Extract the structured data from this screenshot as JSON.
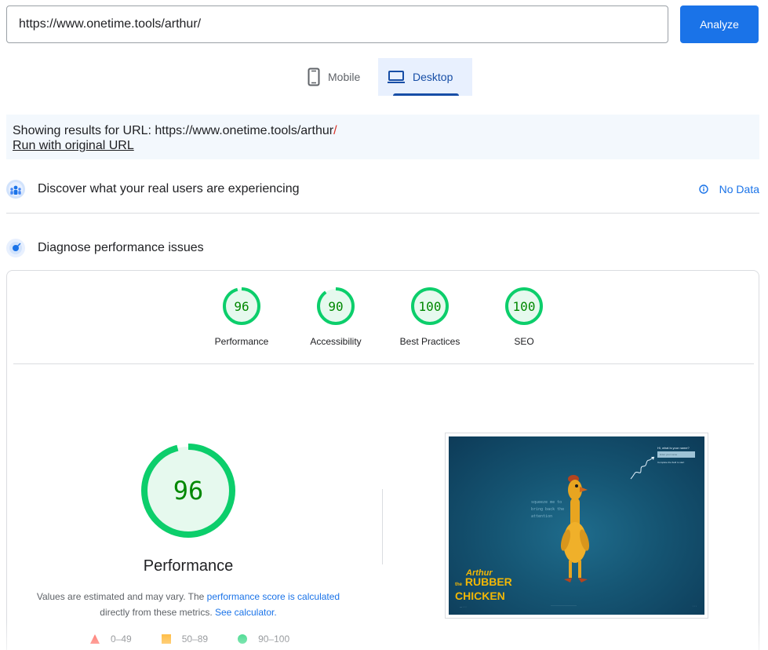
{
  "search": {
    "url_value": "https://www.onetime.tools/arthur/",
    "analyze_label": "Analyze"
  },
  "device_tabs": {
    "mobile_label": "Mobile",
    "desktop_label": "Desktop",
    "selected": "Desktop"
  },
  "notice": {
    "prefix": "Showing results for URL: https://www.onetime.tools/arthur",
    "slash": "/",
    "rerun_label": "Run with original URL"
  },
  "field_data": {
    "title": "Discover what your real users are experiencing",
    "status": "No Data"
  },
  "lab_data": {
    "title": "Diagnose performance issues"
  },
  "scores": [
    {
      "label": "Performance",
      "value": "96",
      "fraction": 0.96
    },
    {
      "label": "Accessibility",
      "value": "90",
      "fraction": 0.9
    },
    {
      "label": "Best Practices",
      "value": "100",
      "fraction": 1.0
    },
    {
      "label": "SEO",
      "value": "100",
      "fraction": 1.0
    }
  ],
  "performance": {
    "score": "96",
    "fraction": 0.96,
    "title": "Performance",
    "disclaimer_prefix": "Values are estimated and may vary. The ",
    "disclaimer_link": "performance score is calculated",
    "disclaimer_mid": " directly from these metrics. ",
    "calculator_link": "See calculator."
  },
  "legend": {
    "poor": "0–49",
    "average": "50–89",
    "good": "90–100"
  },
  "screenshot": {
    "prompt": "Hi, what is your name?",
    "placeholder": "Enter your name",
    "continue": "Complete the field to start",
    "note": "squeeze me to bring back the attention",
    "logo_top": "Arthur",
    "logo_the": "the",
    "logo_line1": "RUBBER",
    "logo_line2": "CHICKEN"
  },
  "colors": {
    "good": "#0cce6b",
    "good_bg": "#e6f9ee",
    "good_text": "#008800",
    "average": "#ffa400",
    "poor": "#ff4e42",
    "accent": "#1a73e8"
  }
}
